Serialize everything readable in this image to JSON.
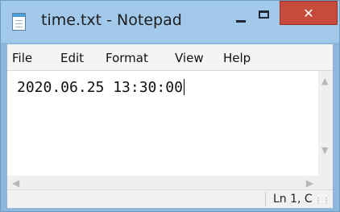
{
  "window": {
    "title": "time.txt - Notepad",
    "close_glyph": "✕"
  },
  "menu": {
    "file": "File",
    "edit": "Edit",
    "format": "Format",
    "view": "View",
    "help": "Help"
  },
  "editor": {
    "content": "2020.06.25 13:30:00"
  },
  "status": {
    "position": "Ln 1, C"
  },
  "colors": {
    "titlebar": "#a2c9ea",
    "close_button": "#c74b3c",
    "menubar": "#f4f4f4",
    "editor_bg": "#ffffff"
  },
  "icons": {
    "app": "notepad-icon",
    "minimize": "minimize-icon",
    "maximize": "maximize-icon",
    "close": "close-icon",
    "scroll_up": "chevron-up-icon",
    "scroll_down": "chevron-down-icon",
    "scroll_left": "chevron-left-icon",
    "scroll_right": "chevron-right-icon",
    "resize": "resize-grip-icon"
  }
}
